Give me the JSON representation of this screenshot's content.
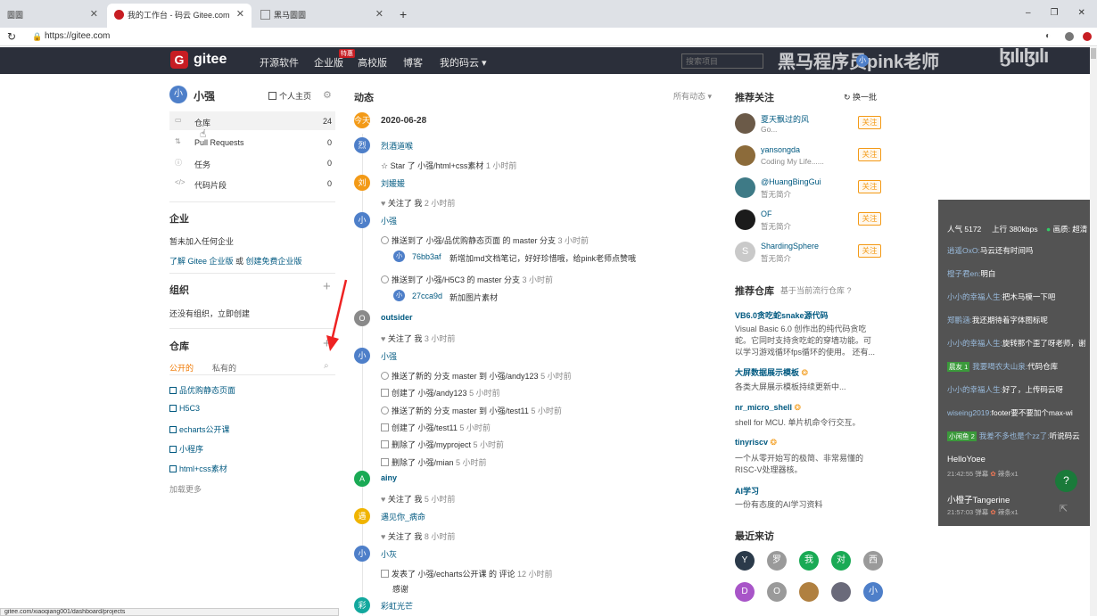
{
  "browser": {
    "tabs": [
      {
        "title": "圖圖"
      },
      {
        "title": "我的工作台 - 码云 Gitee.com"
      },
      {
        "title": "黑马圖圖"
      }
    ],
    "new_tab": "+",
    "url": "https://gitee.com",
    "win_controls": [
      "‒",
      "❐",
      "✕"
    ]
  },
  "nav": {
    "logo": "gitee",
    "links": [
      "开源软件",
      "企业版",
      "高校版",
      "博客",
      "我的码云 ▾"
    ],
    "badge": "特惠",
    "search_placeholder": "搜索项目",
    "watermark": "黑马程序员pink老师"
  },
  "sidebar": {
    "user": {
      "avatar": "小",
      "name": "小强",
      "home_link": "个人主页"
    },
    "menu": [
      {
        "label": "仓库",
        "count": "24"
      },
      {
        "label": "Pull Requests",
        "count": "0"
      },
      {
        "label": "任务",
        "count": "0"
      },
      {
        "label": "代码片段",
        "count": "0"
      }
    ],
    "enterprise": {
      "title": "企业",
      "empty": "暂未加入任何企业",
      "link1": "了解 Gitee 企业版",
      "or": " 或 ",
      "link2": "创建免费企业版"
    },
    "org": {
      "title": "组织",
      "empty": "还没有组织，立即创建",
      "add": "+"
    },
    "repos": {
      "title": "仓库",
      "add": "+",
      "tab_public": "公开的",
      "tab_private": "私有的",
      "items": [
        "品优购静态页面",
        "H5C3",
        "echarts公开课",
        "小程序",
        "html+css素材"
      ],
      "more": "加载更多"
    }
  },
  "feed": {
    "title": "动态",
    "filter": "所有动态 ▾",
    "date_badge": "今天",
    "date": "2020-06-28",
    "users": [
      {
        "avatar": "烈",
        "name": "烈酒道喉"
      },
      {
        "avatar": "刘",
        "name": "刘媛媛"
      },
      {
        "avatar": "小",
        "name": "小强"
      },
      {
        "avatar": "O",
        "name": "outsider"
      },
      {
        "avatar": "小",
        "name": "小强"
      },
      {
        "avatar": "A",
        "name": "ainy"
      },
      {
        "avatar": "遇",
        "name": "遇见你_病命"
      },
      {
        "avatar": "小",
        "name": "小灰"
      },
      {
        "avatar": "彩",
        "name": "彩虹光芒"
      }
    ],
    "lines": [
      "Star 了 小强/html+css素材",
      "关注了 我",
      "推送到了 小强/品优购静态页面 的 master 分支",
      "新增加md文档笔记，好好珍惜哦，给pink老师点赞哦",
      "推送到了 小强/H5C3 的 master 分支",
      "新加图片素材",
      "关注了 我",
      "推送了新的 分支 master 到 小强/andy123",
      "创建了 小强/andy123",
      "推送了新的 分支 master 到 小强/test11",
      "创建了 小强/test11",
      "删除了 小强/myproject",
      "删除了 小强/mian",
      "关注了 我",
      "关注了 我",
      "发表了 小强/echarts公开课 的 评论",
      "感谢"
    ],
    "times": [
      "1 小时前",
      "2 小时前",
      "3 小时前",
      "3 小时前",
      "3 小时前",
      "5 小时前",
      "5 小时前",
      "5 小时前",
      "5 小时前",
      "5 小时前",
      "5 小时前",
      "5 小时前",
      "8 小时前",
      "12 小时前"
    ],
    "hashes": [
      "76bb3af",
      "27cca9d"
    ]
  },
  "right": {
    "rec_title": "推荐关注",
    "refresh": "换一批",
    "follow_label": "关注",
    "people": [
      {
        "name": "夏天飘过的风",
        "desc": "Go..."
      },
      {
        "name": "yansongda",
        "desc": "Coding My Life......"
      },
      {
        "name": "@HuangBingGui",
        "desc": "暂无简介"
      },
      {
        "name": "OF",
        "desc": "暂无简介"
      },
      {
        "name": "ShardingSphere",
        "desc": "暂无简介",
        "avatar": "S"
      }
    ],
    "repo_title": "推荐仓库",
    "repo_sub": "基于当前流行仓库 ?",
    "repos": [
      {
        "name": "VB6.0贪吃蛇snake源代码",
        "desc1": "Visual Basic 6.0 创作出的纯代码贪吃",
        "desc2": "蛇。它同时支持贪吃蛇的穿墙功能。可",
        "desc3": "以学习游戏循环fps循环的使用。 还有..."
      },
      {
        "name": "大屏数据展示模板",
        "desc1": "各类大屏展示模板持续更新中..."
      },
      {
        "name": "nr_micro_shell",
        "desc1": "shell for MCU. 单片机命令行交互。"
      },
      {
        "name": "tinyriscv",
        "desc1": "一个从零开始写的极简、非常易懂的",
        "desc2": "RISC-V处理器核。"
      },
      {
        "name": "AI学习",
        "desc1": "一份有态度的AI学习资料"
      }
    ],
    "visit_title": "最近来访",
    "visitors": [
      "Y",
      "罗",
      "我",
      "对",
      "西",
      "D",
      "O",
      "",
      "",
      "小"
    ]
  },
  "live": {
    "stats": [
      "人气 5172",
      "上行 380kbps",
      "画质: 超清"
    ],
    "chat": [
      {
        "user": "逍遥OxO:",
        "msg": "马云还有时间吗"
      },
      {
        "user": "橙子君en:",
        "msg": "明白"
      },
      {
        "user": "小小的幸福人生:",
        "msg": "把木马模一下吧"
      },
      {
        "user": "郑鹏涵:",
        "msg": "我还期待着字体图标呢"
      },
      {
        "user": "小小的幸福人生:",
        "msg": "旋转那个歪了呀老师，谢"
      },
      {
        "badge": "晨友 1",
        "user": "我要喝农夫山泉:",
        "msg": "代码仓库"
      },
      {
        "user": "小小的幸福人生:",
        "msg": "好了，上传码云呀"
      },
      {
        "user": "wiseing2019:",
        "msg": "footer要不要加个max-wi"
      },
      {
        "badge": "小闲鱼 2",
        "user": "我差不多也是个zz了:",
        "msg": "听说码云"
      }
    ],
    "gifts": [
      {
        "name": "HelloYoee",
        "time": "21:42:55 弹幕",
        "gift": "辣条x1"
      },
      {
        "name": "小橙子Tangerine",
        "time": "21:57:03 弹幕",
        "gift": "辣条x1"
      }
    ],
    "help": "?"
  },
  "status_url": "gitee.com/xiaoqiang001/dashboard/projects"
}
